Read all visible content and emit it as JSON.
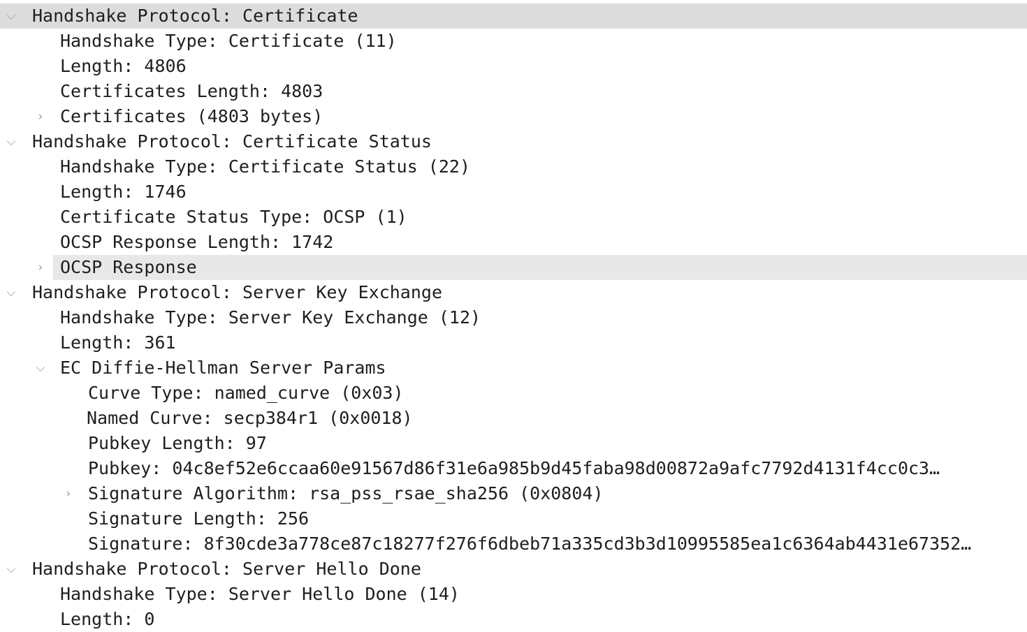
{
  "glyphs": {
    "expanded": "⌵",
    "collapsed": "›"
  },
  "tree": {
    "rows": [
      {
        "level": 0,
        "toggle": "expanded",
        "text": "Handshake Protocol: Certificate",
        "selected": true
      },
      {
        "level": 1,
        "toggle": "none",
        "text": "Handshake Type: Certificate (11)"
      },
      {
        "level": 1,
        "toggle": "none",
        "text": "Length: 4806"
      },
      {
        "level": 1,
        "toggle": "none",
        "text": "Certificates Length: 4803"
      },
      {
        "level": 1,
        "toggle": "collapsed",
        "text": "Certificates (4803 bytes)"
      },
      {
        "level": 0,
        "toggle": "expanded",
        "text": "Handshake Protocol: Certificate Status"
      },
      {
        "level": 1,
        "toggle": "none",
        "text": "Handshake Type: Certificate Status (22)"
      },
      {
        "level": 1,
        "toggle": "none",
        "text": "Length: 1746"
      },
      {
        "level": 1,
        "toggle": "none",
        "text": "Certificate Status Type: OCSP (1)"
      },
      {
        "level": 1,
        "toggle": "none",
        "text": "OCSP Response Length: 1742"
      },
      {
        "level": 1,
        "toggle": "collapsed",
        "text": "OCSP Response",
        "highlighted": true
      },
      {
        "level": 0,
        "toggle": "expanded",
        "text": "Handshake Protocol: Server Key Exchange"
      },
      {
        "level": 1,
        "toggle": "none",
        "text": "Handshake Type: Server Key Exchange (12)"
      },
      {
        "level": 1,
        "toggle": "none",
        "text": "Length: 361"
      },
      {
        "level": 1,
        "toggle": "expanded",
        "text": "EC Diffie-Hellman Server Params"
      },
      {
        "level": 2,
        "toggle": "none",
        "text": "Curve Type: named_curve (0x03)"
      },
      {
        "level": 2,
        "toggle": "none",
        "text": "Named Curve: secp384r1 (0x0018)",
        "nudge": true
      },
      {
        "level": 2,
        "toggle": "none",
        "text": "Pubkey Length: 97"
      },
      {
        "level": 2,
        "toggle": "none",
        "text": "Pubkey: 04c8ef52e6ccaa60e91567d86f31e6a985b9d45faba98d00872a9afc7792d4131f4cc0c3…"
      },
      {
        "level": 2,
        "toggle": "collapsed",
        "text": "Signature Algorithm: rsa_pss_rsae_sha256 (0x0804)"
      },
      {
        "level": 2,
        "toggle": "none",
        "text": "Signature Length: 256"
      },
      {
        "level": 2,
        "toggle": "none",
        "text": "Signature: 8f30cde3a778ce87c18277f276f6dbeb71a335cd3b3d10995585ea1c6364ab4431e67352…"
      },
      {
        "level": 0,
        "toggle": "expanded",
        "text": "Handshake Protocol: Server Hello Done"
      },
      {
        "level": 1,
        "toggle": "none",
        "text": "Handshake Type: Server Hello Done (14)"
      },
      {
        "level": 1,
        "toggle": "none",
        "text": "Length: 0"
      }
    ]
  }
}
